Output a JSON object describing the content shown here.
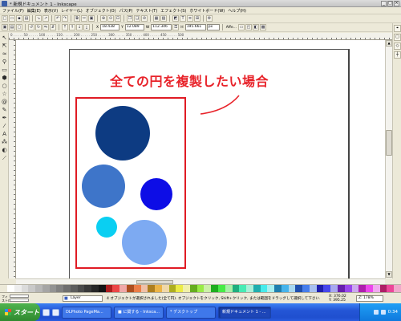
{
  "window": {
    "title": "* 新規ドキュメント 1 - Inkscape",
    "buttons": [
      "_",
      "□",
      "×"
    ]
  },
  "menu": [
    "ファイル(F)",
    "編集(E)",
    "表示(V)",
    "レイヤー(L)",
    "オブジェクト(O)",
    "パス(P)",
    "テキスト(T)",
    "エフェクト(S)",
    "ホワイトボード(W)",
    "ヘルプ(H)"
  ],
  "toolbar_select": {
    "x_label": "X",
    "x_value": "18.438",
    "y_label": "Y",
    "y_value": "12.089",
    "w_label": "W",
    "w_value": "112.346",
    "h_label": "H",
    "h_value": "195.661",
    "unit": "px",
    "affect_label": "Affe..."
  },
  "ruler_numbers": "0 . . . . . 50 . . . . . 100 . . . . . 150 . . . . . 200 . . . . . 250 . . . . . 300 . . . . . 350 . . . . . 400 . . . . . 450 . . . . . 500",
  "canvas": {
    "callout": "全ての円を複製したい場合",
    "callout_color": "#e8232a",
    "selection_color": "#e01b24",
    "circles": [
      {
        "name": "dark-navy-circle",
        "color": "#0d3b82"
      },
      {
        "name": "medium-blue-circle",
        "color": "#3e75c9"
      },
      {
        "name": "bright-blue-circle",
        "color": "#0d0de6"
      },
      {
        "name": "cyan-circle",
        "color": "#0acff2"
      },
      {
        "name": "light-blue-circle",
        "color": "#7daaf2"
      }
    ]
  },
  "status": {
    "fill_label": "フィ",
    "stroke_label": "ストロ",
    "layer": "Layer",
    "message": "4 オブジェクトが選択されました(全て円). オブジェクトをクリック, Shift+クリック, または範囲をドラッグして選択して下さい.",
    "coord_x": "X: 376.02",
    "coord_y": "Y: 395.25",
    "zoom": "Z: 178%"
  },
  "taskbar": {
    "start_label": "スタート",
    "tasks": [
      "DLPhoto PageMa...",
      "■ に関する - Inksca...",
      "* デスクトップ",
      "新規ドキュメント 1 - ..."
    ],
    "clock": "0:34"
  }
}
